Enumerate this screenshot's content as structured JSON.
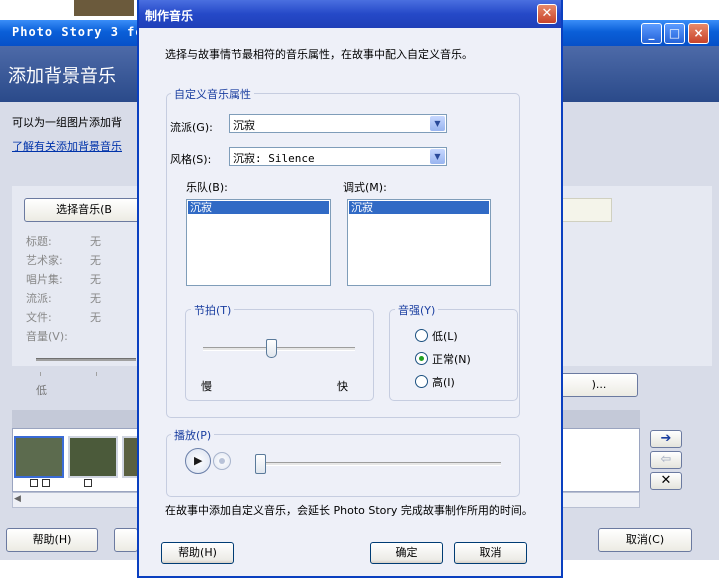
{
  "background_window": {
    "title": "Photo Story 3 fo",
    "header": "添加背景音乐",
    "description": "可以为一组图片添加背",
    "link": "了解有关添加背景音乐",
    "select_music_button": "选择音乐(B",
    "meta": [
      {
        "label": "标题:",
        "value": "无"
      },
      {
        "label": "艺术家:",
        "value": "无"
      },
      {
        "label": "唱片集:",
        "value": "无"
      },
      {
        "label": "流派:",
        "value": "无"
      },
      {
        "label": "文件:",
        "value": "无"
      },
      {
        "label": "音量(V):",
        "value": ""
      }
    ],
    "volume_low_label": "低",
    "edit_button": ")...",
    "help_button": "帮助(H)",
    "cancel_button": "取消(C)",
    "window_buttons": {
      "minimize": "_",
      "maximize": "□",
      "close": "×"
    },
    "arrow_buttons": {
      "right": "➔",
      "left": "⇦",
      "delete": "✕"
    }
  },
  "dialog": {
    "title": "制作音乐",
    "close_glyph": "✕",
    "instruction": "选择与故事情节最相符的音乐属性，在故事中配入自定义音乐。",
    "custom_group": {
      "title": "自定义音乐属性",
      "genre_label": "流派(G):",
      "genre_value": "沉寂",
      "style_label": "风格(S):",
      "style_value": "沉寂: Silence",
      "band_label": "乐队(B):",
      "band_selected": "沉寂",
      "mood_label": "调式(M):",
      "mood_selected": "沉寂"
    },
    "tempo_group": {
      "title": "节拍(T)",
      "slow_label": "慢",
      "fast_label": "快",
      "level": 0.45
    },
    "intensity_group": {
      "title": "音强(Y)",
      "options": [
        {
          "label": "低(L)",
          "selected": false
        },
        {
          "label": "正常(N)",
          "selected": true
        },
        {
          "label": "高(I)",
          "selected": false
        }
      ]
    },
    "play_group": {
      "title": "播放(P)",
      "level": 0.0
    },
    "note": "在故事中添加自定义音乐，会延长 Photo Story 完成故事制作所用的时间。",
    "buttons": {
      "help": "帮助(H)",
      "ok": "确定",
      "cancel": "取消"
    }
  }
}
